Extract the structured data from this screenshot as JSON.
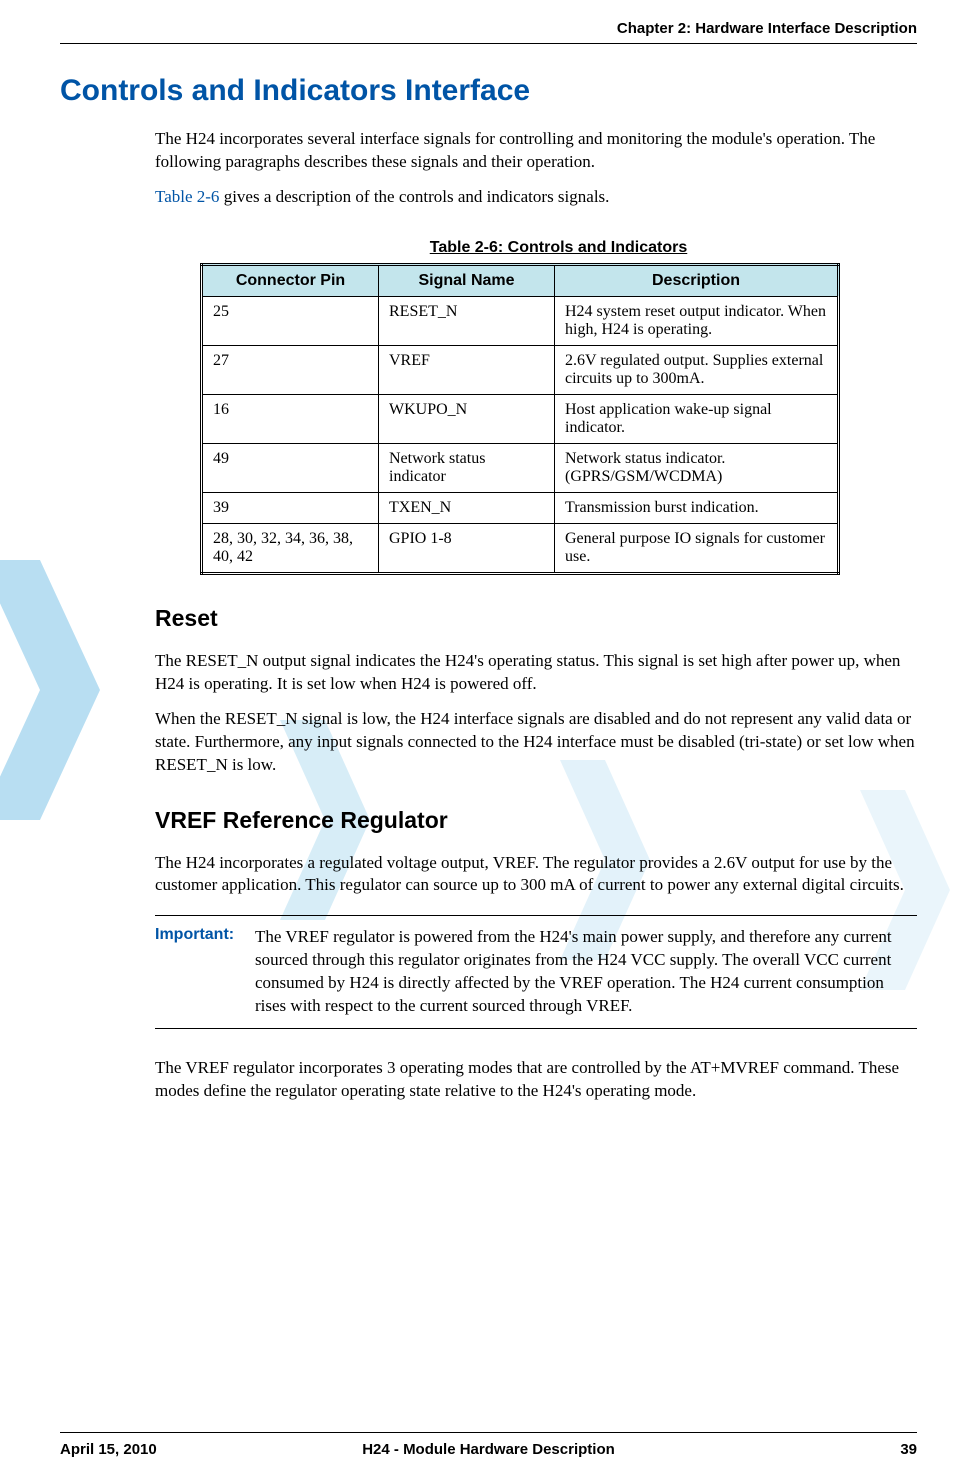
{
  "header": {
    "chapter": "Chapter 2:  Hardware Interface Description"
  },
  "title": "Controls and Indicators Interface",
  "intro": {
    "p1": "The H24 incorporates several interface signals for controlling and monitoring the module's operation. The following paragraphs describes these signals and their operation.",
    "p2_link": "Table 2-6",
    "p2_rest": " gives a description of the controls and indicators signals."
  },
  "table": {
    "caption": "Table 2-6: Controls and Indicators",
    "headers": [
      "Connector Pin",
      "Signal Name",
      "Description"
    ],
    "rows": [
      {
        "pin": "25",
        "signal": "RESET_N",
        "desc": "H24 system reset output indicator. When high, H24 is operating."
      },
      {
        "pin": "27",
        "signal": "VREF",
        "desc": "2.6V regulated output.\nSupplies external circuits up to 300mA."
      },
      {
        "pin": "16",
        "signal": "WKUPO_N",
        "desc": "Host application wake-up signal indicator."
      },
      {
        "pin": "49",
        "signal": "Network status indicator",
        "desc": "Network status indicator. (GPRS/GSM/WCDMA)"
      },
      {
        "pin": "39",
        "signal": "TXEN_N",
        "desc": "Transmission burst indication."
      },
      {
        "pin": "28, 30, 32, 34, 36, 38, 40, 42",
        "signal": "GPIO 1-8",
        "desc": "General purpose IO signals for customer use."
      }
    ]
  },
  "reset": {
    "heading": "Reset",
    "p1": "The RESET_N output signal indicates the H24's operating status. This signal is set high after power up, when H24 is operating. It is set low when H24 is powered off.",
    "p2": "When the RESET_N signal is low, the H24 interface signals are disabled and do not represent any valid data or state. Furthermore, any input signals connected to the H24 interface must be disabled (tri-state) or set low when RESET_N is low."
  },
  "vref": {
    "heading": "VREF Reference Regulator",
    "p1": "The H24 incorporates a regulated voltage output, VREF. The regulator provides a 2.6V output for use by the customer application. This regulator can source up to 300 mA of current to power any external digital circuits.",
    "important_label": "Important:",
    "important_text": "The VREF regulator is powered from the H24's main power supply, and therefore any current sourced through this regulator originates from the H24 VCC supply. The overall VCC current consumed by H24 is directly affected by the VREF operation. The H24 current consumption rises with respect to the current sourced through VREF.",
    "p2": "The VREF regulator incorporates 3 operating modes that are controlled by the AT+MVREF command. These modes define the regulator operating state relative to the H24's operating mode."
  },
  "footer": {
    "left": "April 15, 2010",
    "center": "H24 - Module Hardware Description",
    "right": "39"
  }
}
